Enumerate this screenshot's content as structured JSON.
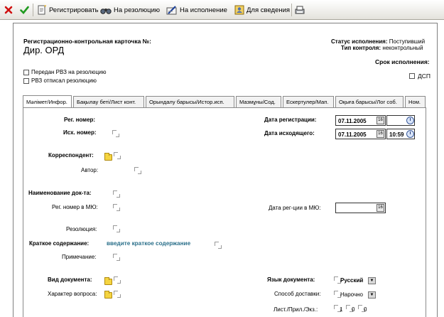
{
  "toolbar": {
    "close_icon": "red-x-icon",
    "ok_icon": "green-check-icon",
    "register": "Регистрировать",
    "to_resolution": "На резолюцию",
    "to_execution": "На исполнение",
    "for_info": "Для сведения",
    "print_icon": "printer-icon"
  },
  "header": {
    "card_title": "Регистрационно-контрольная карточка №:",
    "doc_type": "Дир. ОРД",
    "status_label": "Статус исполнения:",
    "status_value": "Поступивший",
    "control_label": "Тип контроля:",
    "control_value": "неконтрольный",
    "deadline_label": "Срок исполнения:",
    "dsp_label": "ДСП",
    "chk_passed": "Передан РВЗ на резолюцию",
    "chk_written": "РВЗ отписал резолюцию"
  },
  "tabs": [
    {
      "label": "Мәлімет/Инфор."
    },
    {
      "label": "Бақылау беті/Лист конт."
    },
    {
      "label": "Орындалу барысы/Истор.исп."
    },
    {
      "label": "Мазмұны/Сод."
    },
    {
      "label": "Ескертулер/Мап."
    },
    {
      "label": "Оқыға барысы/Лог соб."
    },
    {
      "label": "Ном."
    }
  ],
  "form": {
    "reg_number_label": "Рег. номер:",
    "out_number_label": "Исх. номер:",
    "correspondent_label": "Корреспондент:",
    "author_label": "Автор:",
    "doc_name_label": "Наименование док-та:",
    "mio_reg_label": "Рег. номер в МЮ:",
    "resolution_label": "Резолюция:",
    "summary_label": "Краткое содержание:",
    "summary_placeholder": "введите краткое содержание",
    "note_label": "Примечание:",
    "doc_kind_label": "Вид документа:",
    "question_label": "Характер вопроса:",
    "reg_date_label": "Дата регистрации:",
    "reg_date_value": "07.11.2005",
    "reg_time_value": "",
    "out_date_label": "Дата исходящего:",
    "out_date_value": "07.11.2005",
    "out_time_value": "10:59",
    "mio_date_label": "Дата рег-ции в МЮ:",
    "mio_date_value": "",
    "calendar_glyph": "16",
    "lang_label": "Язык документа:",
    "lang_value": "Русский",
    "delivery_label": "Способ доставки:",
    "delivery_value": "Нарочно",
    "sheets_label": "Лист./Прил./Экз.:",
    "sheets_value": "1",
    "attach_value": "0",
    "copies_value": "0"
  }
}
